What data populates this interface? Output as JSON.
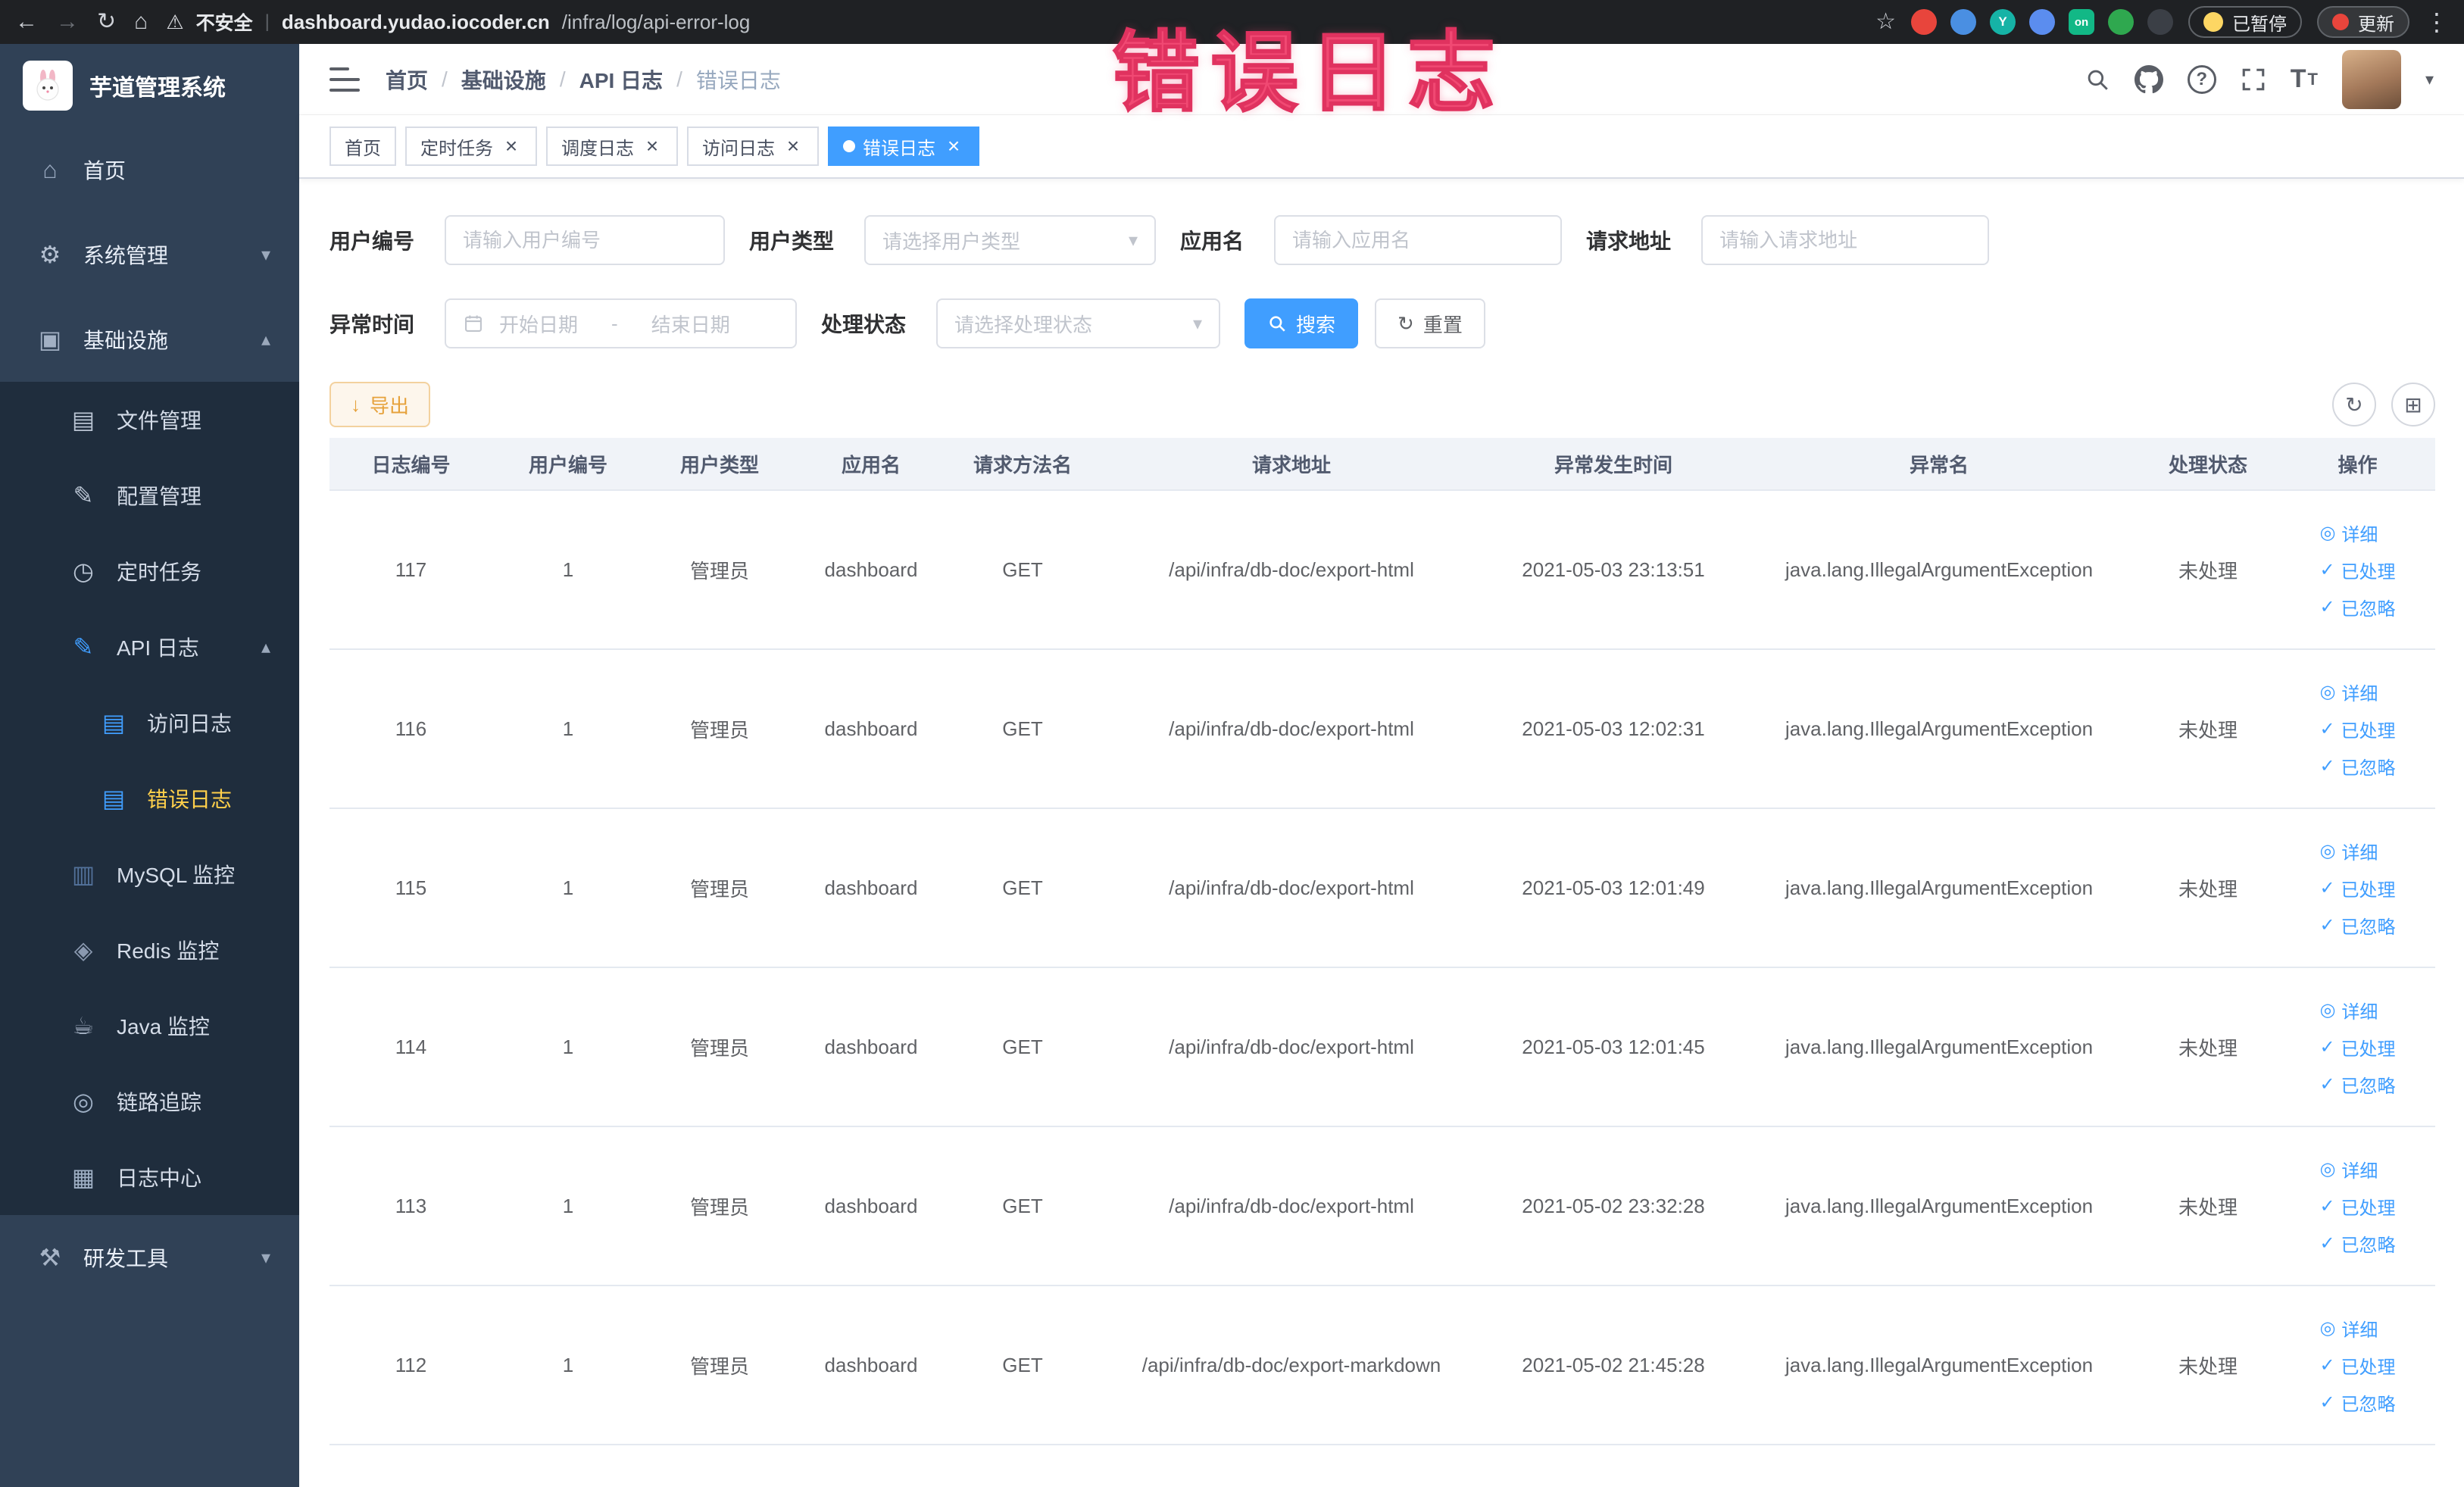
{
  "colors": {
    "accent": "#409EFF",
    "sidebar_bg": "#304156",
    "submenu_bg": "#1f2d3d",
    "active_menu_text": "#ffd04b",
    "warning": "#e6a23c",
    "link_blue": "#409EFF",
    "annotation_pink": "#f14973"
  },
  "icon_glyphs": {
    "back-icon": "←",
    "forward-icon": "→",
    "reload-icon": "↻",
    "browser-home-icon": "⌂",
    "warning-icon": "⚠",
    "star-icon": "☆",
    "kebab-icon": "⋮",
    "url-divider": "|",
    "chevron-down-icon": "▾",
    "chevron-up-icon": "▴",
    "caret-down-icon": "▾",
    "close-icon": "×",
    "breadcrumb-separator": "/",
    "question-icon": "?",
    "refresh-icon": "↻",
    "grid-icon": "⊞",
    "download-icon": "↓",
    "eye-icon": "◎",
    "check-icon": "✓",
    "home-icon": "⌂",
    "gear-icon": "⚙",
    "infra-icon": "▣",
    "file-icon": "▤",
    "config-icon": "✎",
    "task-icon": "◷",
    "api-log-icon": "✎",
    "access-log-icon": "▤",
    "error-log-icon": "▤",
    "mysql-icon": "▥",
    "redis-icon": "◈",
    "java-icon": "☕",
    "trace-icon": "◎",
    "log-center-icon": "▦",
    "tools-icon": "⚒"
  },
  "browser": {
    "security_label": "不安全",
    "url_domain": "dashboard.yudao.iocoder.cn",
    "url_path": "/infra/log/api-error-log",
    "extensions": [
      {
        "name": "ext-red-icon",
        "color": "#e8453c"
      },
      {
        "name": "ext-blue-drop-icon",
        "color": "#4a8fe2"
      },
      {
        "name": "ext-teal-icon",
        "color": "#16b3a6",
        "label": "Y"
      },
      {
        "name": "ext-squares-icon",
        "color": "#5b8def"
      },
      {
        "name": "ext-on-icon",
        "color": "#12b886",
        "label": "on",
        "shape": "square"
      },
      {
        "name": "ext-leaf-icon",
        "color": "#2fa84f"
      },
      {
        "name": "ext-plug-icon",
        "color": "#3b3f46"
      }
    ],
    "paused_label": "已暂停",
    "update_label": "更新"
  },
  "annotation": {
    "text": "错误日志"
  },
  "sidebar": {
    "app_title": "芋道管理系统",
    "items": [
      {
        "key": "home",
        "label": "首页",
        "icon": "home-icon",
        "icon_color": "#98a8bf",
        "level": 1
      },
      {
        "key": "system-mgmt",
        "label": "系统管理",
        "icon": "gear-icon",
        "icon_color": "#b3bfd0",
        "level": 1,
        "arrow": "down"
      },
      {
        "key": "infrastructure",
        "label": "基础设施",
        "icon": "infra-icon",
        "icon_color": "#a2b0c4",
        "level": 1,
        "arrow": "up"
      },
      {
        "key": "file-mgmt",
        "label": "文件管理",
        "icon": "file-icon",
        "icon_color": "#b9c4d3",
        "level": 2
      },
      {
        "key": "config-mgmt",
        "label": "配置管理",
        "icon": "config-icon",
        "icon_color": "#b9c4d3",
        "level": 2
      },
      {
        "key": "scheduled-tasks",
        "label": "定时任务",
        "icon": "task-icon",
        "icon_color": "#b9c4d3",
        "level": 2
      },
      {
        "key": "api-log",
        "label": "API 日志",
        "icon": "api-log-icon",
        "icon_color": "#409EFF",
        "level": 2,
        "arrow": "up"
      },
      {
        "key": "access-log",
        "label": "访问日志",
        "icon": "access-log-icon",
        "icon_color": "#409EFF",
        "level": 3
      },
      {
        "key": "error-log",
        "label": "错误日志",
        "icon": "error-log-icon",
        "icon_color": "#409EFF",
        "level": 3,
        "active": true
      },
      {
        "key": "mysql-monitor",
        "label": "MySQL 监控",
        "icon": "mysql-icon",
        "icon_color": "#53729b",
        "level": 2
      },
      {
        "key": "redis-monitor",
        "label": "Redis 监控",
        "icon": "redis-icon",
        "icon_color": "#8a99b0",
        "level": 2
      },
      {
        "key": "java-monitor",
        "label": "Java 监控",
        "icon": "java-icon",
        "icon_color": "#a7b4c6",
        "level": 2
      },
      {
        "key": "trace",
        "label": "链路追踪",
        "icon": "trace-icon",
        "icon_color": "#9fb0c5",
        "level": 2
      },
      {
        "key": "log-center",
        "label": "日志中心",
        "icon": "log-center-icon",
        "icon_color": "#9fb0c5",
        "level": 2
      },
      {
        "key": "dev-tools",
        "label": "研发工具",
        "icon": "tools-icon",
        "icon_color": "#a7b4c6",
        "level": 1,
        "arrow": "down"
      }
    ]
  },
  "header": {
    "breadcrumb": [
      "首页",
      "基础设施",
      "API 日志",
      "错误日志"
    ]
  },
  "tabs": [
    {
      "label": "首页",
      "closable": false,
      "active": false
    },
    {
      "label": "定时任务",
      "closable": true,
      "active": false
    },
    {
      "label": "调度日志",
      "closable": true,
      "active": false
    },
    {
      "label": "访问日志",
      "closable": true,
      "active": false
    },
    {
      "label": "错误日志",
      "closable": true,
      "active": true
    }
  ],
  "filters": {
    "user_id": {
      "label": "用户编号",
      "placeholder": "请输入用户编号"
    },
    "user_type": {
      "label": "用户类型",
      "placeholder": "请选择用户类型"
    },
    "app_name": {
      "label": "应用名",
      "placeholder": "请输入应用名"
    },
    "request_url": {
      "label": "请求地址",
      "placeholder": "请输入请求地址"
    },
    "exception_time": {
      "label": "异常时间",
      "start_placeholder": "开始日期",
      "separator": "-",
      "end_placeholder": "结束日期"
    },
    "process_status": {
      "label": "处理状态",
      "placeholder": "请选择处理状态"
    },
    "search_button": "搜索",
    "reset_button": "重置"
  },
  "toolbar": {
    "export_button": "导出"
  },
  "table": {
    "columns": [
      "日志编号",
      "用户编号",
      "用户类型",
      "应用名",
      "请求方法名",
      "请求地址",
      "异常发生时间",
      "异常名",
      "处理状态",
      "操作"
    ],
    "actions": [
      {
        "key": "detail",
        "label": "详细",
        "icon": "eye-icon"
      },
      {
        "key": "processed",
        "label": "已处理",
        "icon": "check-icon"
      },
      {
        "key": "ignored",
        "label": "已忽略",
        "icon": "check-icon"
      }
    ],
    "rows": [
      {
        "id": "117",
        "user_id": "1",
        "user_type": "管理员",
        "app": "dashboard",
        "method": "GET",
        "url": "/api/infra/db-doc/export-html",
        "time": "2021-05-03 23:13:51",
        "exception": "java.lang.IllegalArgumentException",
        "status": "未处理"
      },
      {
        "id": "116",
        "user_id": "1",
        "user_type": "管理员",
        "app": "dashboard",
        "method": "GET",
        "url": "/api/infra/db-doc/export-html",
        "time": "2021-05-03 12:02:31",
        "exception": "java.lang.IllegalArgumentException",
        "status": "未处理"
      },
      {
        "id": "115",
        "user_id": "1",
        "user_type": "管理员",
        "app": "dashboard",
        "method": "GET",
        "url": "/api/infra/db-doc/export-html",
        "time": "2021-05-03 12:01:49",
        "exception": "java.lang.IllegalArgumentException",
        "status": "未处理"
      },
      {
        "id": "114",
        "user_id": "1",
        "user_type": "管理员",
        "app": "dashboard",
        "method": "GET",
        "url": "/api/infra/db-doc/export-html",
        "time": "2021-05-03 12:01:45",
        "exception": "java.lang.IllegalArgumentException",
        "status": "未处理"
      },
      {
        "id": "113",
        "user_id": "1",
        "user_type": "管理员",
        "app": "dashboard",
        "method": "GET",
        "url": "/api/infra/db-doc/export-html",
        "time": "2021-05-02 23:32:28",
        "exception": "java.lang.IllegalArgumentException",
        "status": "未处理"
      },
      {
        "id": "112",
        "user_id": "1",
        "user_type": "管理员",
        "app": "dashboard",
        "method": "GET",
        "url": "/api/infra/db-doc/export-markdown",
        "time": "2021-05-02 21:45:28",
        "exception": "java.lang.IllegalArgumentException",
        "status": "未处理"
      }
    ]
  }
}
